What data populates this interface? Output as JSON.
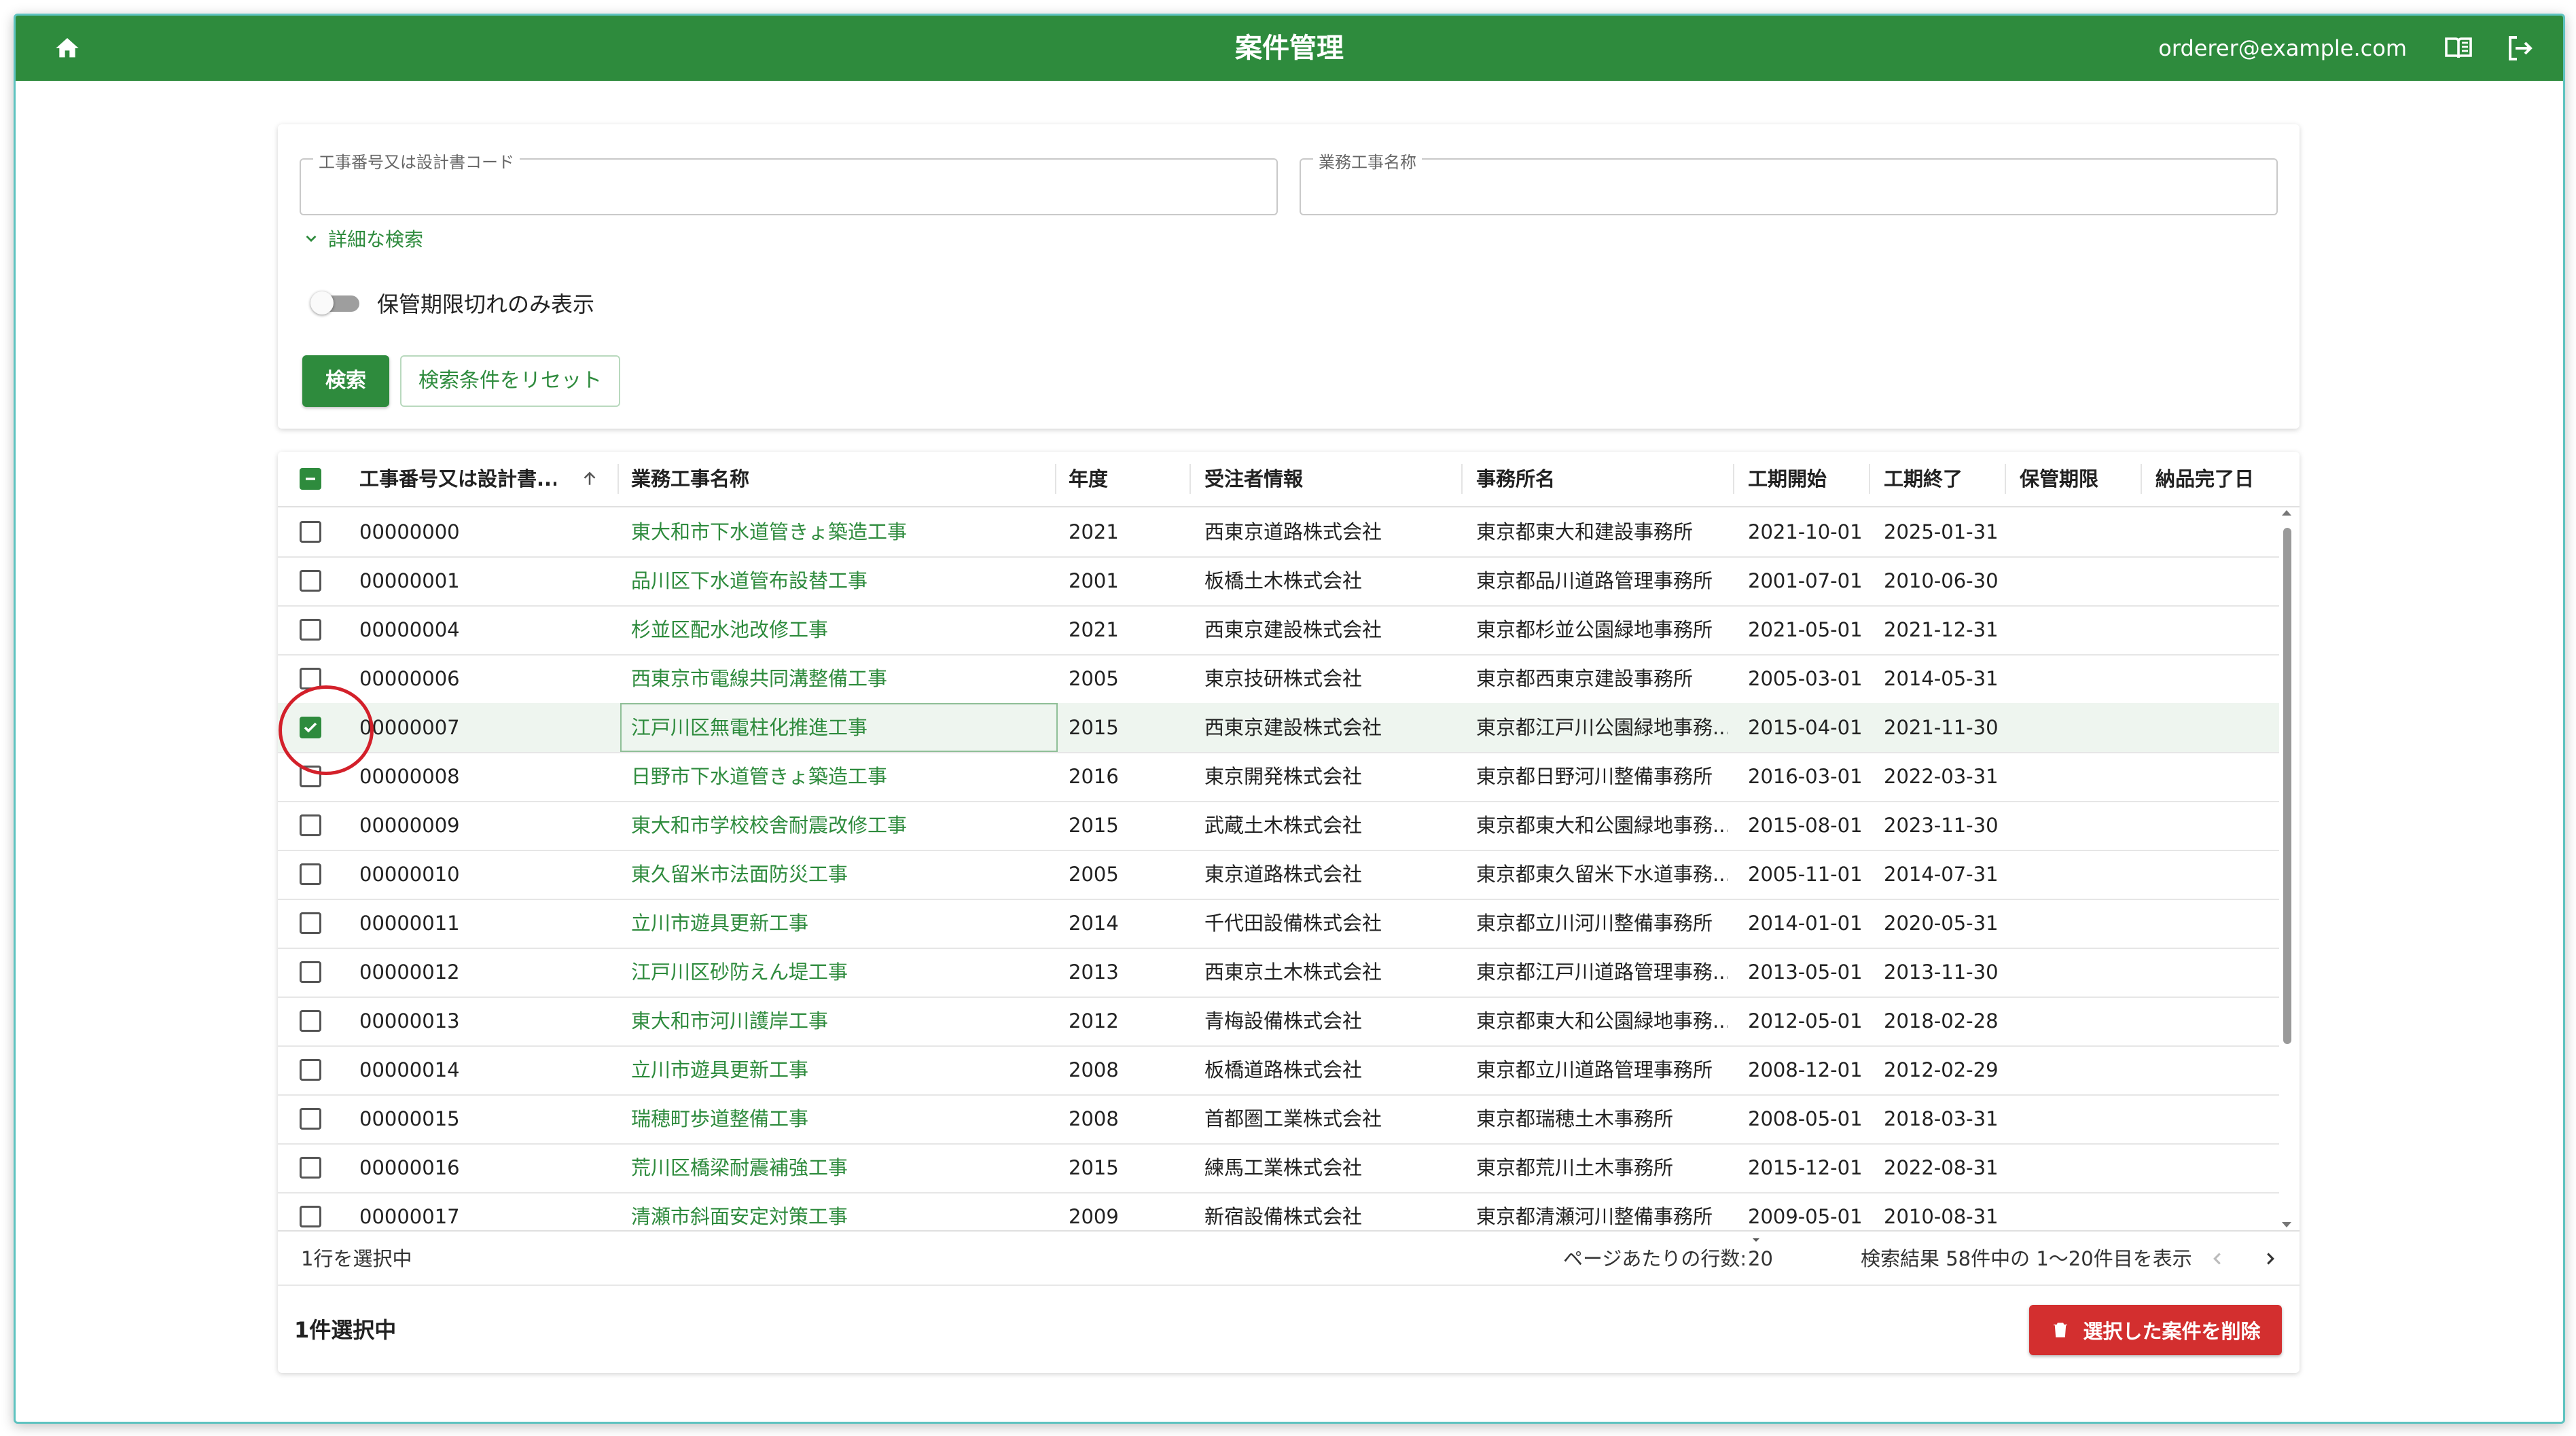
{
  "app": {
    "title": "案件管理",
    "user_email": "orderer@example.com",
    "accent_color": "#2e8b3d",
    "icons": [
      "home-icon",
      "manual-book-icon",
      "logout-icon"
    ]
  },
  "search": {
    "code_label": "工事番号又は設計書コード",
    "code_value": "",
    "name_label": "業務工事名称",
    "name_value": "",
    "advanced_label": "詳細な検索",
    "expired_toggle_label": "保管期限切れのみ表示",
    "expired_toggle_on": false,
    "search_button": "検索",
    "reset_button": "検索条件をリセット"
  },
  "grid": {
    "columns": [
      "工事番号又は設計書...",
      "業務工事名称",
      "年度",
      "受注者情報",
      "事務所名",
      "工期開始",
      "工期終了",
      "保管期限",
      "納品完了日"
    ],
    "rows": [
      {
        "code": "00000000",
        "name": "東大和市下水道管きょ築造工事",
        "year": "2021",
        "contractor": "西東京道路株式会社",
        "office": "東京都東大和建設事務所",
        "start": "2021-10-01",
        "end": "2025-01-31",
        "retention": "",
        "delivered": "",
        "checked": false
      },
      {
        "code": "00000001",
        "name": "品川区下水道管布設替工事",
        "year": "2001",
        "contractor": "板橋土木株式会社",
        "office": "東京都品川道路管理事務所",
        "start": "2001-07-01",
        "end": "2010-06-30",
        "retention": "",
        "delivered": "",
        "checked": false
      },
      {
        "code": "00000004",
        "name": "杉並区配水池改修工事",
        "year": "2021",
        "contractor": "西東京建設株式会社",
        "office": "東京都杉並公園緑地事務所",
        "start": "2021-05-01",
        "end": "2021-12-31",
        "retention": "",
        "delivered": "",
        "checked": false
      },
      {
        "code": "00000006",
        "name": "西東京市電線共同溝整備工事",
        "year": "2005",
        "contractor": "東京技研株式会社",
        "office": "東京都西東京建設事務所",
        "start": "2005-03-01",
        "end": "2014-05-31",
        "retention": "",
        "delivered": "",
        "checked": false
      },
      {
        "code": "00000007",
        "name": "江戸川区無電柱化推進工事",
        "year": "2015",
        "contractor": "西東京建設株式会社",
        "office": "東京都江戸川公園緑地事務...",
        "start": "2015-04-01",
        "end": "2021-11-30",
        "retention": "",
        "delivered": "",
        "checked": true
      },
      {
        "code": "00000008",
        "name": "日野市下水道管きょ築造工事",
        "year": "2016",
        "contractor": "東京開発株式会社",
        "office": "東京都日野河川整備事務所",
        "start": "2016-03-01",
        "end": "2022-03-31",
        "retention": "",
        "delivered": "",
        "checked": false
      },
      {
        "code": "00000009",
        "name": "東大和市学校校舎耐震改修工事",
        "year": "2015",
        "contractor": "武蔵土木株式会社",
        "office": "東京都東大和公園緑地事務...",
        "start": "2015-08-01",
        "end": "2023-11-30",
        "retention": "",
        "delivered": "",
        "checked": false
      },
      {
        "code": "00000010",
        "name": "東久留米市法面防災工事",
        "year": "2005",
        "contractor": "東京道路株式会社",
        "office": "東京都東久留米下水道事務...",
        "start": "2005-11-01",
        "end": "2014-07-31",
        "retention": "",
        "delivered": "",
        "checked": false
      },
      {
        "code": "00000011",
        "name": "立川市遊具更新工事",
        "year": "2014",
        "contractor": "千代田設備株式会社",
        "office": "東京都立川河川整備事務所",
        "start": "2014-01-01",
        "end": "2020-05-31",
        "retention": "",
        "delivered": "",
        "checked": false
      },
      {
        "code": "00000012",
        "name": "江戸川区砂防えん堤工事",
        "year": "2013",
        "contractor": "西東京土木株式会社",
        "office": "東京都江戸川道路管理事務...",
        "start": "2013-05-01",
        "end": "2013-11-30",
        "retention": "",
        "delivered": "",
        "checked": false
      },
      {
        "code": "00000013",
        "name": "東大和市河川護岸工事",
        "year": "2012",
        "contractor": "青梅設備株式会社",
        "office": "東京都東大和公園緑地事務...",
        "start": "2012-05-01",
        "end": "2018-02-28",
        "retention": "",
        "delivered": "",
        "checked": false
      },
      {
        "code": "00000014",
        "name": "立川市遊具更新工事",
        "year": "2008",
        "contractor": "板橋道路株式会社",
        "office": "東京都立川道路管理事務所",
        "start": "2008-12-01",
        "end": "2012-02-29",
        "retention": "",
        "delivered": "",
        "checked": false
      },
      {
        "code": "00000015",
        "name": "瑞穂町歩道整備工事",
        "year": "2008",
        "contractor": "首都圏工業株式会社",
        "office": "東京都瑞穂土木事務所",
        "start": "2008-05-01",
        "end": "2018-03-31",
        "retention": "",
        "delivered": "",
        "checked": false
      },
      {
        "code": "00000016",
        "name": "荒川区橋梁耐震補強工事",
        "year": "2015",
        "contractor": "練馬工業株式会社",
        "office": "東京都荒川土木事務所",
        "start": "2015-12-01",
        "end": "2022-08-31",
        "retention": "",
        "delivered": "",
        "checked": false
      },
      {
        "code": "00000017",
        "name": "清瀬市斜面安定対策工事",
        "year": "2009",
        "contractor": "新宿設備株式会社",
        "office": "東京都清瀬河川整備事務所",
        "start": "2009-05-01",
        "end": "2010-08-31",
        "retention": "",
        "delivered": "",
        "checked": false
      }
    ],
    "footer": {
      "selected_text": "1行を選択中",
      "rows_per_page_label": "ページあたりの行数:",
      "rows_per_page_value": "20",
      "pagination_text": "検索結果 58件中の 1〜20件目を表示"
    },
    "sort_indicator": "arrow-up-icon"
  },
  "selection_bar": {
    "count_text": "1件選択中",
    "delete_button": "選択した案件を削除",
    "delete_color": "#d32f2f"
  }
}
